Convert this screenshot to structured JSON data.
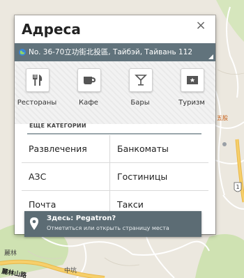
{
  "map": {
    "labels": [
      "五股",
      "麗林",
      "中坑"
    ],
    "highway_shield": "1",
    "road_name": "麗林山路",
    "colors": {
      "land": "#ece8df",
      "park": "#c8dfa8",
      "road_major": "#f6cf6a",
      "road_minor": "#ffffff"
    }
  },
  "dialog": {
    "title": "Адреса",
    "close_icon": "close-icon",
    "location_text": "No. 36-70立功街北投區, Тайбэй, Тайвань 112"
  },
  "categories": [
    {
      "label": "Рестораны",
      "icon": "restaurant-icon"
    },
    {
      "label": "Кафе",
      "icon": "cafe-icon"
    },
    {
      "label": "Бары",
      "icon": "bar-icon"
    },
    {
      "label": "Туризм",
      "icon": "tourism-icon"
    }
  ],
  "more_categories": {
    "header": "ЕЩЕ КАТЕГОРИИ",
    "items": [
      "Развлечения",
      "Банкоматы",
      "АЗС",
      "Гостиницы",
      "Почта",
      "Такси"
    ]
  },
  "here_banner": {
    "title": "Здесь: Pegatron?",
    "subtitle": "Отметиться или открыть страницу места",
    "icon": "location-pin-icon"
  },
  "colors": {
    "header_bar": "#61737c",
    "banner": "#5c6c74",
    "divider": "#9aa6ab"
  }
}
